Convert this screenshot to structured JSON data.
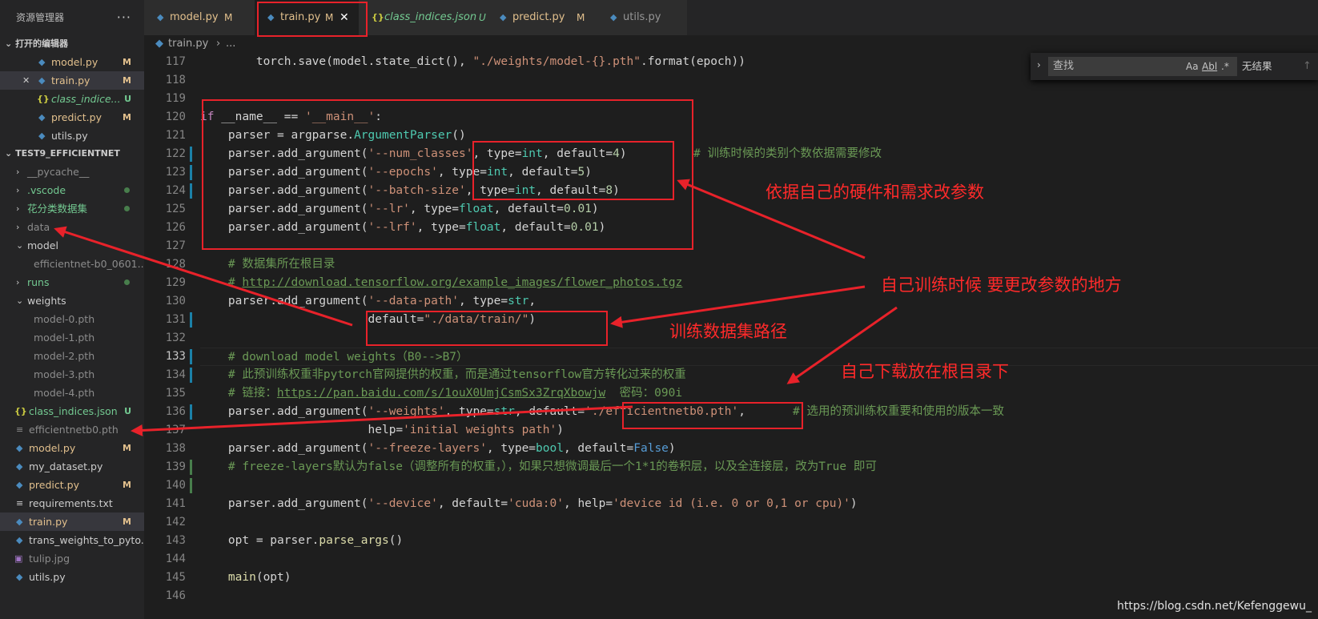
{
  "sidebar": {
    "title": "资源管理器",
    "more": "···",
    "open_editors_label": "打开的编辑器",
    "open_editors": [
      {
        "name": "model.py",
        "badge": "M"
      },
      {
        "name": "train.py",
        "badge": "M"
      },
      {
        "name": "class_indice...",
        "badge": "U"
      },
      {
        "name": "predict.py",
        "badge": "M"
      },
      {
        "name": "utils.py",
        "badge": ""
      }
    ],
    "project_label": "TEST9_EFFICIENTNET",
    "tree": [
      {
        "name": "__pycache__"
      },
      {
        "name": ".vscode"
      },
      {
        "name": "花分类数据集"
      },
      {
        "name": "data"
      },
      {
        "name": "model"
      },
      {
        "name": "efficientnet-b0_0601..."
      },
      {
        "name": "runs"
      },
      {
        "name": "weights"
      },
      {
        "name": "model-0.pth"
      },
      {
        "name": "model-1.pth"
      },
      {
        "name": "model-2.pth"
      },
      {
        "name": "model-3.pth"
      },
      {
        "name": "model-4.pth"
      },
      {
        "name": "class_indices.json",
        "badge": "U"
      },
      {
        "name": "efficientnetb0.pth"
      },
      {
        "name": "model.py",
        "badge": "M"
      },
      {
        "name": "my_dataset.py"
      },
      {
        "name": "predict.py",
        "badge": "M"
      },
      {
        "name": "requirements.txt"
      },
      {
        "name": "train.py",
        "badge": "M"
      },
      {
        "name": "trans_weights_to_pyto..."
      },
      {
        "name": "tulip.jpg"
      },
      {
        "name": "utils.py"
      }
    ]
  },
  "tabs": [
    {
      "name": "model.py",
      "badge": "M"
    },
    {
      "name": "train.py",
      "badge": "M",
      "close": "✕"
    },
    {
      "name": "class_indices.json",
      "badge": "U"
    },
    {
      "name": "predict.py",
      "badge": "M"
    },
    {
      "name": "utils.py",
      "badge": ""
    }
  ],
  "breadcrumb": {
    "file": "train.py",
    "sep": "›",
    "rest": "..."
  },
  "find": {
    "placeholder": "查找",
    "opt1": "Aa",
    "opt2": "Abl",
    "opt3": ".*",
    "result": "无结果",
    "up": "↑"
  },
  "lines": [
    {
      "n": "117",
      "mark": ""
    },
    {
      "n": "118",
      "mark": ""
    },
    {
      "n": "119",
      "mark": ""
    },
    {
      "n": "120",
      "mark": ""
    },
    {
      "n": "121",
      "mark": ""
    },
    {
      "n": "122",
      "mark": "m"
    },
    {
      "n": "123",
      "mark": "m"
    },
    {
      "n": "124",
      "mark": "m"
    },
    {
      "n": "125",
      "mark": ""
    },
    {
      "n": "126",
      "mark": ""
    },
    {
      "n": "127",
      "mark": ""
    },
    {
      "n": "128",
      "mark": ""
    },
    {
      "n": "129",
      "mark": ""
    },
    {
      "n": "130",
      "mark": ""
    },
    {
      "n": "131",
      "mark": "m"
    },
    {
      "n": "132",
      "mark": ""
    },
    {
      "n": "133",
      "mark": "m"
    },
    {
      "n": "134",
      "mark": "m"
    },
    {
      "n": "135",
      "mark": ""
    },
    {
      "n": "136",
      "mark": "m"
    },
    {
      "n": "137",
      "mark": ""
    },
    {
      "n": "138",
      "mark": ""
    },
    {
      "n": "139",
      "mark": "a"
    },
    {
      "n": "140",
      "mark": "a"
    },
    {
      "n": "141",
      "mark": ""
    },
    {
      "n": "142",
      "mark": ""
    },
    {
      "n": "143",
      "mark": ""
    },
    {
      "n": "144",
      "mark": ""
    },
    {
      "n": "145",
      "mark": ""
    },
    {
      "n": "146",
      "mark": ""
    }
  ],
  "code": {
    "l117_a": "        torch.save(model.state_dict(), ",
    "l117_s": "\"./weights/model-{}.pth\"",
    "l117_b": ".format(epoch))",
    "l120_if": "if",
    "l120_a": " __name__ == ",
    "l120_s": "'__main__'",
    "l120_b": ":",
    "l121_a": "    parser = argparse.",
    "l121_f": "ArgumentParser",
    "l121_b": "()",
    "add": "    parser.add_argument(",
    "l122_s": "'--num_classes'",
    "l122_b": ", type=",
    "l122_t": "int",
    "l122_c": ", default=",
    "l122_n": "4",
    "l122_e": ")",
    "l122_cmt": "# 训练时候的类别个数依据需要修改",
    "l123_s": "'--epochs'",
    "l123_n": "5",
    "l124_s": "'--batch-size'",
    "l124_n": "8",
    "l125_s": "'--lr'",
    "l125_t": "float",
    "l125_n": "0.01",
    "l126_s": "'--lrf'",
    "l126_n": "0.01",
    "l128": "    # 数据集所在根目录",
    "l129_a": "    # ",
    "l129_link": "http://download.tensorflow.org/example_images/flower_photos.tgz",
    "l130_s": "'--data-path'",
    "l130_b": ", type=",
    "l130_t": "str",
    "l130_c": ",",
    "l131_a": "                        default=",
    "l131_s": "\"./data/train/\"",
    "l131_b": ")",
    "l133": "    # download model weights（B0-->B7）",
    "l134": "    # 此预训练权重非pytorch官网提供的权重，而是通过tensorflow官方转化过来的权重",
    "l135_a": "    # 链接：",
    "l135_link": "https://pan.baidu.com/s/1ouX0UmjCsmSx3ZrqXbowjw",
    "l135_b": "  密码：090i",
    "l136_s": "'--weights'",
    "l136_b": ", type=",
    "l136_t": "str",
    "l136_c": ", default=",
    "l136_v": "'./efficientnetb0.pth'",
    "l136_e": ",",
    "l136_cmt": "# 选用的预训练权重要和使用的版本一致",
    "l137_a": "                        help=",
    "l137_s": "'initial weights path'",
    "l137_b": ")",
    "l138_s": "'--freeze-layers'",
    "l138_b": ", type=",
    "l138_t": "bool",
    "l138_c": ", default=",
    "l138_k": "False",
    "l138_e": ")",
    "l139": "    # freeze-layers默认为false（调整所有的权重，），如果只想微调最后一个1*1的卷积层，以及全连接层，改为True 即可",
    "l141_s": "'--device'",
    "l141_b": ", default=",
    "l141_v": "'cuda:0'",
    "l141_c": ", help=",
    "l141_h": "'device id (i.e. 0 or 0,1 or cpu)'",
    "l141_e": ")",
    "l143_a": "    opt = parser.",
    "l143_f": "parse_args",
    "l143_b": "()",
    "l145_f": "main",
    "l145_b": "(opt)",
    "comma_type": ", type=",
    "comma_default": ", default=",
    "close_paren": ")",
    "int": "int"
  },
  "annotations": {
    "a1": "依据自己的硬件和需求改参数",
    "a2": "自己训练时候 要更改参数的地方",
    "a3": "训练数据集路径",
    "a4": "自己下载放在根目录下"
  },
  "watermark": "https://blog.csdn.net/Kefenggewu_",
  "colors": {
    "annotation": "#e8222a",
    "modified": "#e2c08d",
    "untracked": "#73c991"
  }
}
